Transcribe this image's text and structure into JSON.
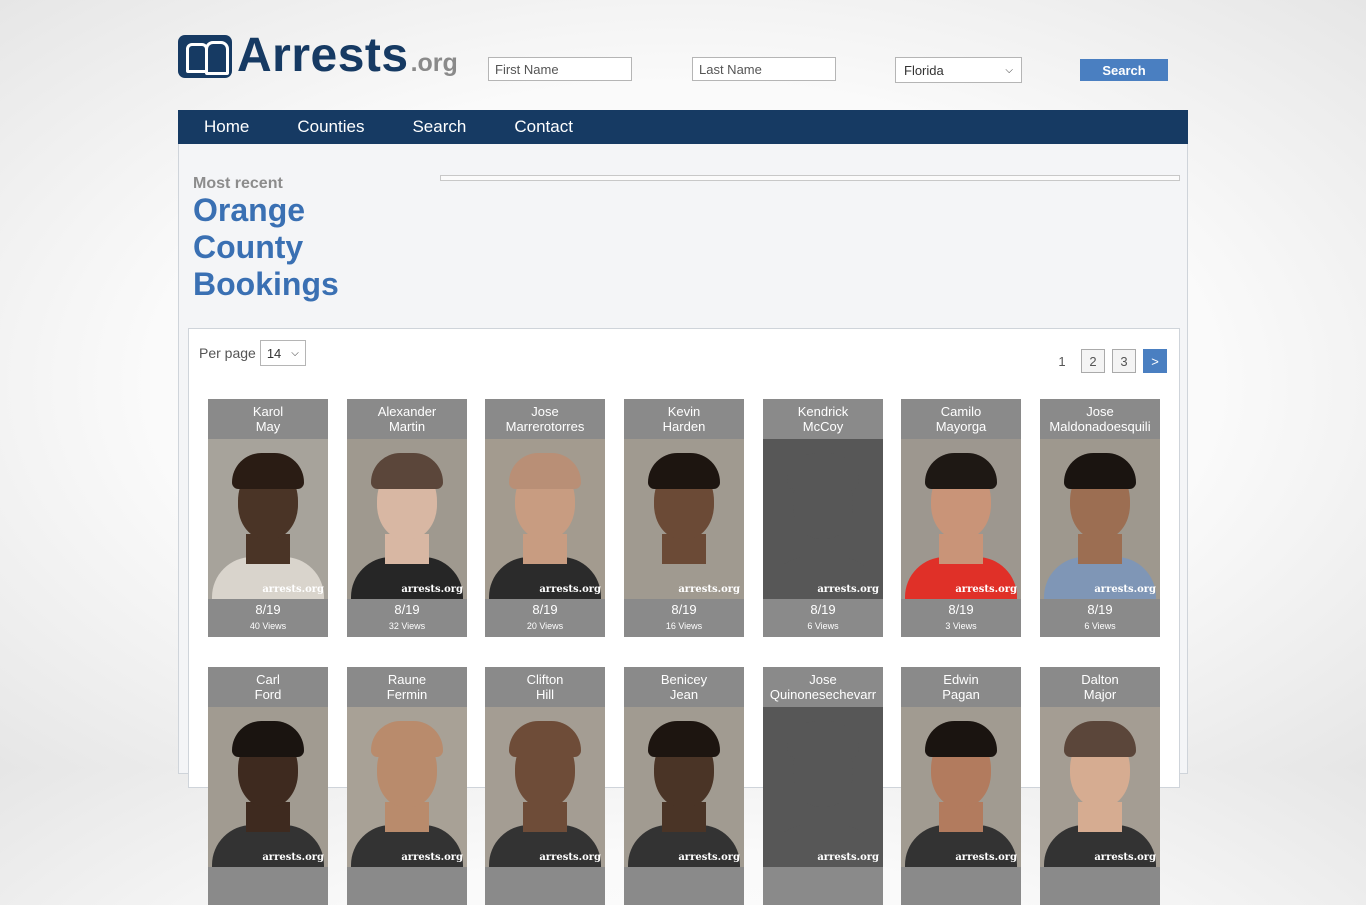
{
  "header": {
    "logo_text": "Arrests",
    "logo_suffix": ".org",
    "first_name_placeholder": "First Name",
    "last_name_placeholder": "Last Name",
    "state_selected": "Florida",
    "search_label": "Search"
  },
  "nav": [
    "Home",
    "Counties",
    "Search",
    "Contact"
  ],
  "main": {
    "recent_label": "Most recent",
    "county_title": "Orange County Bookings"
  },
  "listing": {
    "per_page_label": "Per page",
    "per_page_value": "14",
    "pages": [
      "1",
      "2",
      "3",
      ">"
    ]
  },
  "watermark": "arrests.org",
  "bookings_row1": [
    {
      "first": "Karol",
      "last": "May",
      "date": "8/19",
      "views": "40 Views",
      "bg": "#a7a39b",
      "skin": "#4a3426",
      "hair": "#2a1c14",
      "shirt": "#d9d4cc"
    },
    {
      "first": "Alexander",
      "last": "Martin",
      "date": "8/19",
      "views": "32 Views",
      "bg": "#9f998f",
      "skin": "#d8b7a3",
      "hair": "#5b463a",
      "shirt": "#262626"
    },
    {
      "first": "Jose",
      "last": "Marrerotorres",
      "date": "8/19",
      "views": "20 Views",
      "bg": "#a39b8f",
      "skin": "#c89c81",
      "hair": "#b98f76",
      "shirt": "#2b2b2b"
    },
    {
      "first": "Kevin",
      "last": "Harden",
      "date": "8/19",
      "views": "16 Views",
      "bg": "#a09a90",
      "skin": "#6b4a36",
      "hair": "#1d1510",
      "shirt": "#a09a90"
    },
    {
      "first": "Kendrick",
      "last": "McCoy",
      "date": "8/19",
      "views": "6 Views",
      "bg": "#575757",
      "skin": "#575757",
      "hair": "#575757",
      "shirt": "#575757"
    },
    {
      "first": "Camilo",
      "last": "Mayorga",
      "date": "8/19",
      "views": "3 Views",
      "bg": "#9d978f",
      "skin": "#c99478",
      "hair": "#1e1814",
      "shirt": "#e03028"
    },
    {
      "first": "Jose",
      "last": "Maldonadoesquili",
      "date": "8/19",
      "views": "6 Views",
      "bg": "#9e988e",
      "skin": "#9c6e52",
      "hair": "#1a1410",
      "shirt": "#7f96b6"
    }
  ],
  "bookings_row2": [
    {
      "first": "Carl",
      "last": "Ford",
      "bg": "#a19b91",
      "skin": "#3e2a1f",
      "hair": "#1a1410",
      "shirt": "#333333"
    },
    {
      "first": "Raune",
      "last": "Fermin",
      "bg": "#a8a196",
      "skin": "#b98b6c",
      "hair": "#b98b6c",
      "shirt": "#333333"
    },
    {
      "first": "Clifton",
      "last": "Hill",
      "bg": "#a49d93",
      "skin": "#6e4c38",
      "hair": "#6e4c38",
      "shirt": "#333333"
    },
    {
      "first": "Benicey",
      "last": "Jean",
      "bg": "#a19b91",
      "skin": "#4a3426",
      "hair": "#1d1510",
      "shirt": "#333333"
    },
    {
      "first": "Jose",
      "last": "Quinonesechevarr",
      "bg": "#575757",
      "skin": "#575757",
      "hair": "#575757",
      "shirt": "#575757"
    },
    {
      "first": "Edwin",
      "last": "Pagan",
      "bg": "#a19b91",
      "skin": "#b27b5e",
      "hair": "#1a1410",
      "shirt": "#333333"
    },
    {
      "first": "Dalton",
      "last": "Major",
      "bg": "#a49d93",
      "skin": "#d6ac91",
      "hair": "#5b463a",
      "shirt": "#333333"
    }
  ]
}
